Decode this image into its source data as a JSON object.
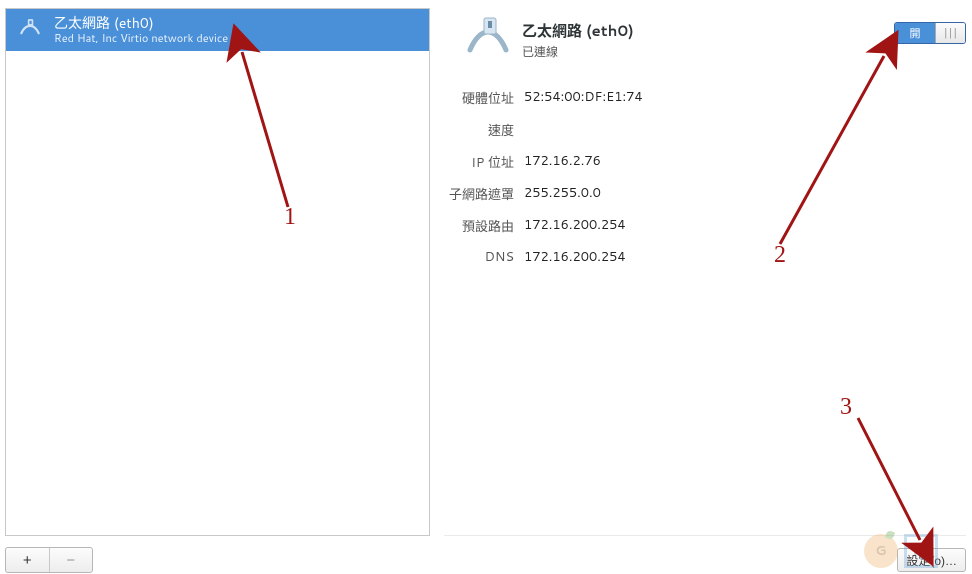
{
  "sidebar": {
    "items": [
      {
        "title": "乙太網路 (eth0)",
        "subtitle": "Red Hat, Inc Virtio network device"
      }
    ]
  },
  "sidebar_actions": {
    "add": "+",
    "remove": "−"
  },
  "details": {
    "title": "乙太網路 (eth0)",
    "status": "已連線",
    "toggle_on": "開",
    "toggle_off": "|||",
    "rows": [
      {
        "label": "硬體位址",
        "value": "52:54:00:DF:E1:74"
      },
      {
        "label": "速度",
        "value": ""
      },
      {
        "label": "IP 位址",
        "value": "172.16.2.76"
      },
      {
        "label": "子網路遮罩",
        "value": "255.255.0.0"
      },
      {
        "label": "預設路由",
        "value": "172.16.200.254"
      },
      {
        "label": "DNS",
        "value": "172.16.200.254"
      }
    ]
  },
  "settings_button": "設定(o)…",
  "annotations": {
    "n1": "1",
    "n2": "2",
    "n3": "3"
  }
}
